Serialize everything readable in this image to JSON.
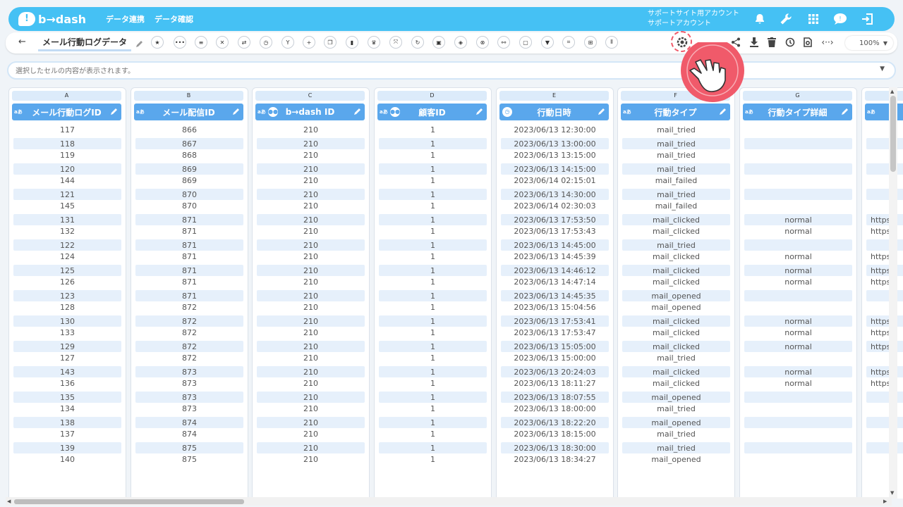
{
  "app": {
    "logo_text": "b→dash"
  },
  "header": {
    "nav": [
      "データ連携",
      "データ確認"
    ],
    "account_line1": "サポートサイト用アカウント",
    "account_line2": "サポートアカウント",
    "icons": [
      "bell-icon",
      "wrench-icon",
      "grid-icon",
      "chat-icon",
      "logout-icon"
    ]
  },
  "toolbar": {
    "back": "←",
    "title": "メール行動ログデータ",
    "zoom": "100%"
  },
  "cellbar": {
    "placeholder": "選択したセルの内容が表示されます。"
  },
  "columns": [
    {
      "letter": "A",
      "name": "メール行動ログID",
      "type": "aあ",
      "icon": ""
    },
    {
      "letter": "B",
      "name": "メール配信ID",
      "type": "aあ",
      "icon": ""
    },
    {
      "letter": "C",
      "name": "b→dash ID",
      "type": "aあ",
      "icon": "people"
    },
    {
      "letter": "D",
      "name": "顧客ID",
      "type": "aあ",
      "icon": "people"
    },
    {
      "letter": "E",
      "name": "行動日時",
      "type": "",
      "icon": "clock"
    },
    {
      "letter": "F",
      "name": "行動タイプ",
      "type": "aあ",
      "icon": ""
    },
    {
      "letter": "G",
      "name": "行動タイプ詳細",
      "type": "aあ",
      "icon": ""
    },
    {
      "letter": "",
      "name": "",
      "type": "aあ",
      "icon": ""
    }
  ],
  "rows": [
    [
      "117",
      "866",
      "210",
      "1",
      "2023/06/13 12:30:00",
      "mail_tried",
      "",
      ""
    ],
    [
      "118",
      "867",
      "210",
      "1",
      "2023/06/13 13:00:00",
      "mail_tried",
      "",
      ""
    ],
    [
      "119",
      "868",
      "210",
      "1",
      "2023/06/13 13:15:00",
      "mail_tried",
      "",
      ""
    ],
    [
      "120",
      "869",
      "210",
      "1",
      "2023/06/13 14:15:00",
      "mail_tried",
      "",
      ""
    ],
    [
      "144",
      "869",
      "210",
      "1",
      "2023/06/14 02:15:01",
      "mail_failed",
      "",
      ""
    ],
    [
      "121",
      "870",
      "210",
      "1",
      "2023/06/13 14:30:00",
      "mail_tried",
      "",
      ""
    ],
    [
      "145",
      "870",
      "210",
      "1",
      "2023/06/14 02:30:03",
      "mail_failed",
      "",
      ""
    ],
    [
      "131",
      "871",
      "210",
      "1",
      "2023/06/13 17:53:50",
      "mail_clicked",
      "normal",
      "https"
    ],
    [
      "132",
      "871",
      "210",
      "1",
      "2023/06/13 17:53:43",
      "mail_clicked",
      "normal",
      "https"
    ],
    [
      "122",
      "871",
      "210",
      "1",
      "2023/06/13 14:45:00",
      "mail_tried",
      "",
      ""
    ],
    [
      "124",
      "871",
      "210",
      "1",
      "2023/06/13 14:45:39",
      "mail_clicked",
      "normal",
      "https"
    ],
    [
      "125",
      "871",
      "210",
      "1",
      "2023/06/13 14:46:12",
      "mail_clicked",
      "normal",
      "https"
    ],
    [
      "126",
      "871",
      "210",
      "1",
      "2023/06/13 14:47:14",
      "mail_clicked",
      "normal",
      "https"
    ],
    [
      "123",
      "871",
      "210",
      "1",
      "2023/06/13 14:45:35",
      "mail_opened",
      "",
      ""
    ],
    [
      "128",
      "872",
      "210",
      "1",
      "2023/06/13 15:04:56",
      "mail_opened",
      "",
      ""
    ],
    [
      "130",
      "872",
      "210",
      "1",
      "2023/06/13 17:53:41",
      "mail_clicked",
      "normal",
      "https"
    ],
    [
      "133",
      "872",
      "210",
      "1",
      "2023/06/13 17:53:47",
      "mail_clicked",
      "normal",
      "https"
    ],
    [
      "129",
      "872",
      "210",
      "1",
      "2023/06/13 15:05:00",
      "mail_clicked",
      "normal",
      "https"
    ],
    [
      "127",
      "872",
      "210",
      "1",
      "2023/06/13 15:00:00",
      "mail_tried",
      "",
      ""
    ],
    [
      "143",
      "873",
      "210",
      "1",
      "2023/06/13 20:24:03",
      "mail_clicked",
      "normal",
      "https"
    ],
    [
      "136",
      "873",
      "210",
      "1",
      "2023/06/13 18:11:27",
      "mail_clicked",
      "normal",
      "https"
    ],
    [
      "135",
      "873",
      "210",
      "1",
      "2023/06/13 18:07:55",
      "mail_opened",
      "",
      ""
    ],
    [
      "134",
      "873",
      "210",
      "1",
      "2023/06/13 18:00:00",
      "mail_tried",
      "",
      ""
    ],
    [
      "138",
      "874",
      "210",
      "1",
      "2023/06/13 18:22:20",
      "mail_opened",
      "",
      ""
    ],
    [
      "137",
      "874",
      "210",
      "1",
      "2023/06/13 18:15:00",
      "mail_tried",
      "",
      ""
    ],
    [
      "139",
      "875",
      "210",
      "1",
      "2023/06/13 18:30:00",
      "mail_tried",
      "",
      ""
    ],
    [
      "140",
      "875",
      "210",
      "1",
      "2023/06/13 18:34:27",
      "mail_opened",
      "",
      ""
    ]
  ],
  "colors": {
    "header": "#45c1f4",
    "column_header": "#5aa7ec",
    "alt_row": "#e6f0fb",
    "pointer": "#f05a6a"
  }
}
